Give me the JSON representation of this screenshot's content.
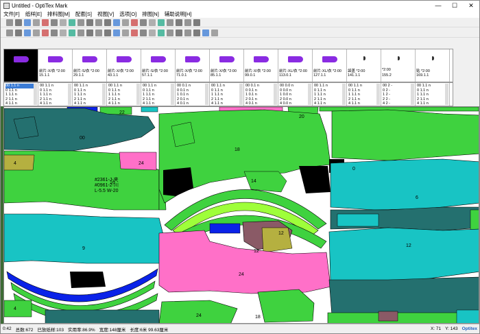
{
  "window": {
    "title": "Untitled - OptiTex Mark"
  },
  "window_controls": {
    "minimize": "—",
    "maximize": "☐",
    "close": "✕"
  },
  "menu": [
    "文件[F]",
    "纸样[E]",
    "排料图[M]",
    "配套[S]",
    "视图[V]",
    "选项[O]",
    "排图[N]",
    "辅助说明[H]"
  ],
  "pieces": [
    {
      "label1": "前片-X/衣",
      "qty1": "*2:00",
      "label2": "1.1.1"
    },
    {
      "label1": "前片-X/衣",
      "qty1": "*2:00",
      "label2": "15.1.1"
    },
    {
      "label1": "前片-S/衣",
      "qty1": "*2:00",
      "label2": "29.1.1"
    },
    {
      "label1": "前片-X/衣",
      "qty1": "*2:00",
      "label2": "43.1.1"
    },
    {
      "label1": "前片-S/衣",
      "qty1": "*2:00",
      "label2": "57.1.1"
    },
    {
      "label1": "前片-X/衣",
      "qty1": "*2:00",
      "label2": "71.0.1"
    },
    {
      "label1": "前片-X/衣",
      "qty1": "*2:00",
      "label2": "85.1.1"
    },
    {
      "label1": "前片-X/衣",
      "qty1": "*2:00",
      "label2": "99.0.1"
    },
    {
      "label1": "前片-XL/衣",
      "qty1": "*2:00",
      "label2": "113.0.1"
    },
    {
      "label1": "前片-XL/衣",
      "qty1": "*2:00",
      "label2": "127.1.1"
    },
    {
      "label1": "袋盖",
      "qty1": "*2:00",
      "label2": "141.1.1"
    },
    {
      "label1": "",
      "qty1": "*2:00",
      "label2": "155.2"
    },
    {
      "label1": "贴",
      "qty1": "*2:00",
      "label2": "169.1.1"
    }
  ],
  "quantities": [
    [
      "00 1.1 n",
      "0 1.1 n",
      "1 1.1 n",
      "2 1.1 n",
      "4 1.1 n",
      "6 1.1 n"
    ],
    [
      "00 1.1 n",
      "0 1.1 n",
      "1 1.1 n",
      "2 1.1 n",
      "4 1.1 n",
      "6 1.1 n"
    ],
    [
      "00 1.1 n",
      "0 1.1 n",
      "1 1.1 n",
      "2 1.1 n",
      "4 1.1 n",
      "6 1.1 n"
    ],
    [
      "00 1.1 n",
      "0 1.1 n",
      "1 1.1 n",
      "2 1.1 n",
      "4 1.1 n",
      "6 1.1 n"
    ],
    [
      "00 1.1 n",
      "0 1.1 n",
      "1 1.1 n",
      "2 1.1 n",
      "4 1.1 n",
      "6 1.1 n"
    ],
    [
      "00 0.1 n",
      "0 0.1 n",
      "1 0.1 n",
      "2 0.1 n",
      "4 0.1 n",
      "6 0.1 n"
    ],
    [
      "00 1.1 n",
      "0 1.1 n",
      "1 1.1 n",
      "2 1.1 n",
      "4 1.1 n",
      "6 1.1 n"
    ],
    [
      "00 0.1 n",
      "0 0.1 n",
      "1 0.1 n",
      "2 0.1 n",
      "4 0.1 n",
      "6 0.1 n"
    ],
    [
      "00 0.0 n",
      "0 0.0 n",
      "1 0.0 n",
      "2 0.0 n",
      "4 0.0 n",
      "6 0.0 n"
    ],
    [
      "00 1.1 n",
      "0 1.1 n",
      "1 1.1 n",
      "2 1.1 n",
      "4 1.1 n",
      "6 1.1 n"
    ],
    [
      "00 1.1 n",
      "0 1.1 n",
      "1 1.1 n",
      "2 1.1 n",
      "4 1.1 n",
      "6 1.1 n"
    ],
    [
      "00 2 -",
      "0 2 -",
      "1 2 -",
      "2 2 -",
      "4 2 -",
      "6 2 -"
    ],
    [
      "00 1.1 n",
      "0 1.1 n",
      "1 1.1 n",
      "2 1.1 n",
      "4 1.1 n",
      "6 1.1 n"
    ]
  ],
  "canvas_labels": {
    "p22": "22",
    "p20": "20",
    "p14": "14",
    "p00": "00",
    "p18": "18",
    "p4": "4",
    "p24": "24",
    "p8": "8",
    "p6": "6",
    "p16": "16",
    "p9": "9",
    "p12": "12",
    "p12b": "12",
    "p0": "0",
    "p4b": "4",
    "p18b": "18",
    "p24b": "24",
    "p24c": "24",
    "p12c": "12",
    "style1": "#2361-J-夹",
    "style2": "#0961-2-川",
    "style3": "L-5.5 W-20"
  },
  "status": {
    "scale": "0:42",
    "total": "总数:672",
    "placed": "已放纸样:103",
    "util": "实用率:86.9%",
    "width": "宽度:148厘米",
    "length": "长度:6米 99.63厘米",
    "x": "X: 71",
    "y": "Y: 143",
    "brand": "Optitex"
  },
  "colors": {
    "teal": "#24706f",
    "lime": "#3fd23f",
    "cyan": "#18c4c4",
    "pink": "#ff70c8",
    "blue": "#0a22e8",
    "olive": "#b5b040",
    "mauve": "#8a5a66",
    "black": "#000000",
    "purple": "#8a2be2"
  }
}
